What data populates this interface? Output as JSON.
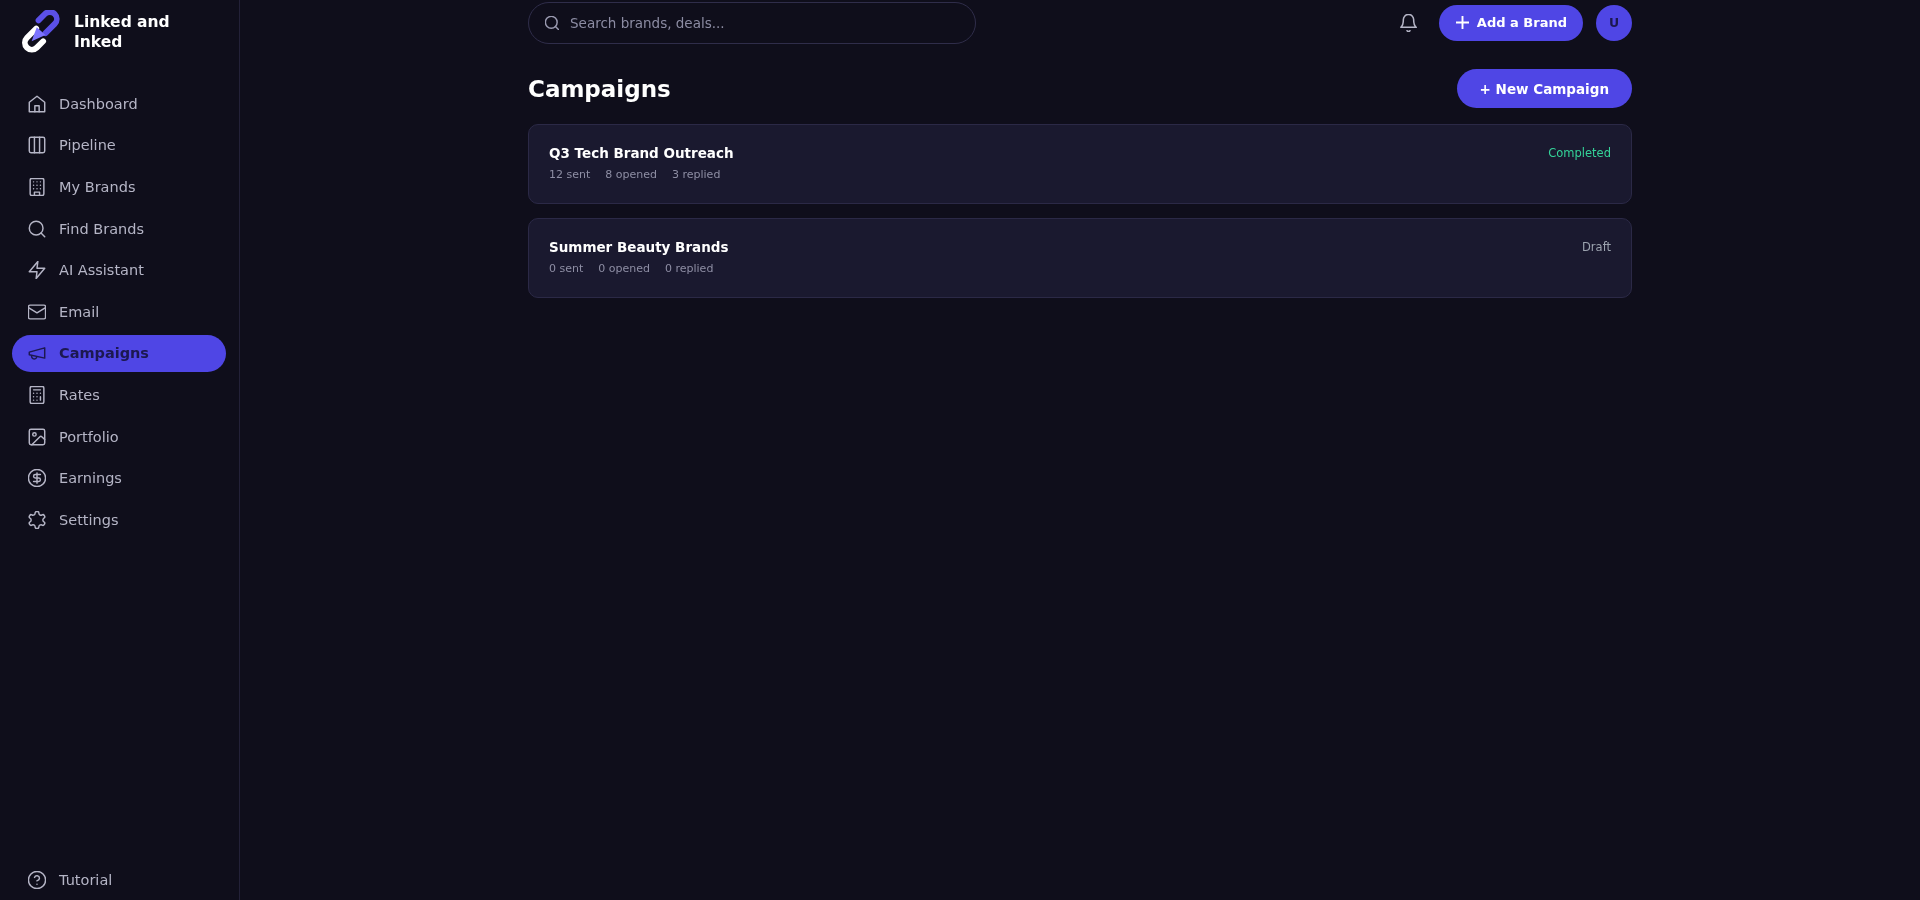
{
  "sidebar": {
    "brand": "Linked and Inked",
    "items": [
      {
        "label": "Dashboard",
        "selected": false
      },
      {
        "label": "Pipeline",
        "selected": false
      },
      {
        "label": "My Brands",
        "selected": false
      },
      {
        "label": "Find Brands",
        "selected": false
      },
      {
        "label": "AI Assistant",
        "selected": false
      },
      {
        "label": "Email",
        "selected": false
      },
      {
        "label": "Campaigns",
        "selected": true
      },
      {
        "label": "Rates",
        "selected": false
      },
      {
        "label": "Portfolio",
        "selected": false
      },
      {
        "label": "Earnings",
        "selected": false
      },
      {
        "label": "Settings",
        "selected": false
      }
    ],
    "footer_items": [
      {
        "label": "Tutorial",
        "selected": false
      }
    ]
  },
  "header": {
    "search": {
      "placeholder": "Search brands, deals..."
    },
    "add_button": {
      "label": "Add a Brand"
    },
    "avatar": {
      "initial": "U"
    }
  },
  "page": {
    "title": "Campaigns",
    "new_button": {
      "label": "+ New Campaign"
    }
  },
  "campaigns": [
    {
      "name": "Q3 Tech Brand Outreach",
      "stats": [
        "12 sent",
        "8 opened",
        "3 replied"
      ],
      "status": {
        "label": "Completed",
        "color": "#34d399"
      }
    },
    {
      "name": "Summer Beauty Brands",
      "stats": [
        "0 sent",
        "0 opened",
        "0 replied"
      ],
      "status": {
        "label": "Draft",
        "color": "#9ca3af"
      }
    }
  ]
}
